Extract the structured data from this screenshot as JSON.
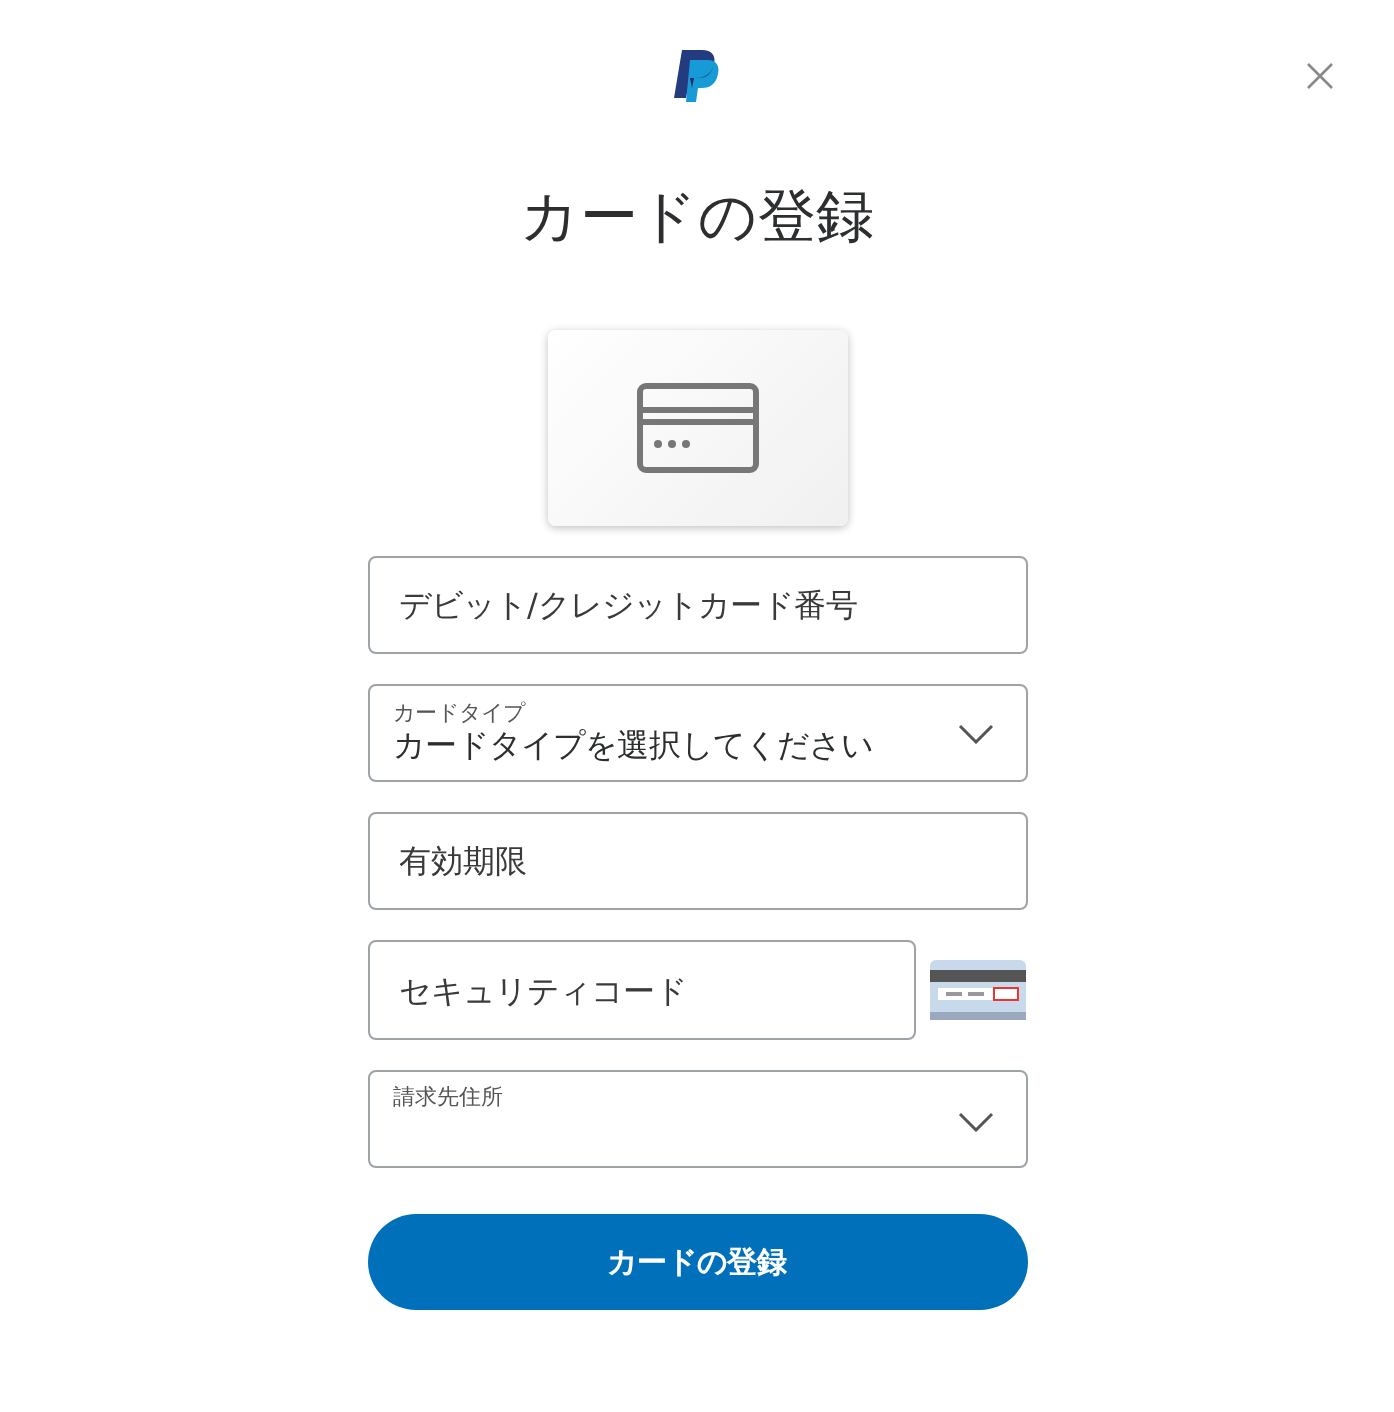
{
  "title": "カードの登録",
  "fields": [
    {
      "kind": "input",
      "placeholder": "デビット/クレジットカード番号"
    },
    {
      "kind": "select",
      "label": "カードタイプ",
      "value": "カードタイプを選択してください"
    },
    {
      "kind": "input",
      "placeholder": "有効期限"
    },
    {
      "kind": "security",
      "placeholder": "セキュリティコード"
    },
    {
      "kind": "select",
      "label": "請求先住所"
    }
  ],
  "submit": "カードの登録"
}
